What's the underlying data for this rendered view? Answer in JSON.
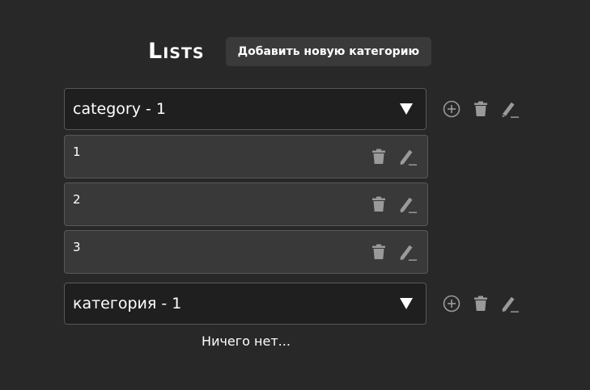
{
  "header": {
    "title": "Lists",
    "add_category_label": "Добавить новую категорию"
  },
  "categories": [
    {
      "name": "category - 1",
      "items": [
        {
          "name": "1"
        },
        {
          "name": "2"
        },
        {
          "name": "3"
        }
      ]
    },
    {
      "name": "категория - 1",
      "empty_text": "Ничего нет..."
    }
  ],
  "icons": {
    "add": "plus-circle-icon",
    "delete": "trash-icon",
    "edit": "pencil-icon",
    "expand": "caret-down-icon"
  },
  "colors": {
    "background": "#282828",
    "category_bg": "#1f1f1f",
    "item_bg": "#393939",
    "border": "#585858",
    "icon": "#9a9a9a",
    "button_bg": "#3a3a3a"
  }
}
